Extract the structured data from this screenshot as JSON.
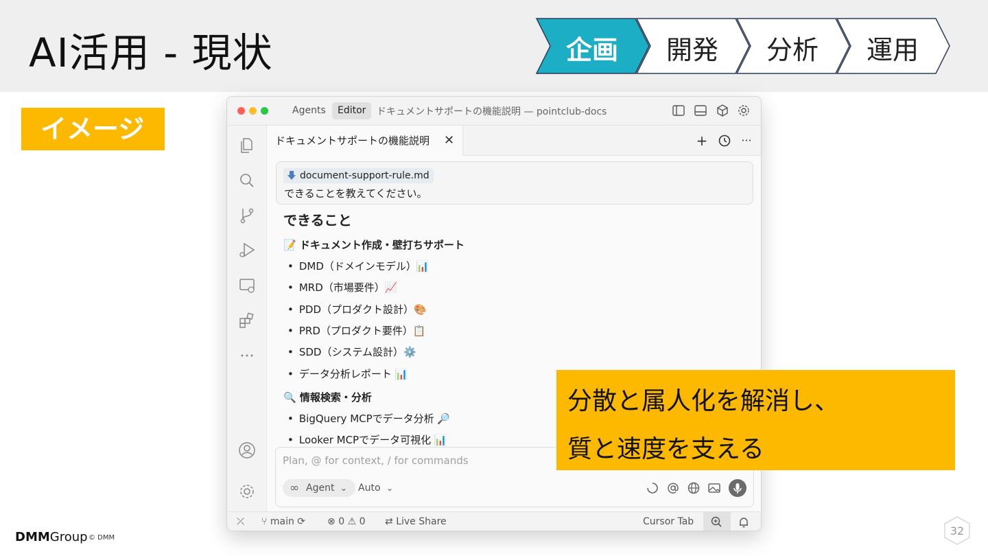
{
  "slide": {
    "title": "AI活用 - 現状",
    "steps": [
      "企画",
      "開発",
      "分析",
      "運用"
    ],
    "active_step_color": "#1baec5",
    "image_tag": "イメージ",
    "callout_lines": [
      "分散と属人化を解消し、",
      "質と速度を支える"
    ],
    "callout_color": "#fcb900",
    "footer_logo_dmm": "DMM",
    "footer_logo_group": "Group",
    "footer_copyright": "© DMM",
    "page_number": "32"
  },
  "window": {
    "mode_buttons": [
      "Agents",
      "Editor"
    ],
    "active_mode": "Editor",
    "title": "ドキュメントサポートの機能説明 — pointclub-docs",
    "titlebar_icons": [
      "sidebar-left-icon",
      "panel-bottom-icon",
      "cube-icon",
      "gear-icon"
    ],
    "sidebar_icons": [
      "files-icon",
      "search-icon",
      "source-control-icon",
      "run-debug-icon",
      "remote-explorer-icon",
      "extensions-icon",
      "more-icon",
      "account-icon",
      "settings-icon"
    ],
    "tab": {
      "label": "ドキュメントサポートの機能説明",
      "close": "✕",
      "tools": [
        "+",
        "history-icon",
        "···"
      ]
    },
    "message": {
      "attachment": "document-support-rule.md",
      "text": "できることを教えてください。"
    },
    "response": {
      "heading": "できること",
      "sections": [
        {
          "title": "📝 ドキュメント作成・壁打ちサポート",
          "items": [
            "DMD（ドメインモデル）📊",
            "MRD（市場要件）📈",
            "PDD（プロダクト設計）🎨",
            "PRD（プロダクト要件）📋",
            "SDD（システム設計）⚙️",
            "データ分析レポート 📊"
          ]
        },
        {
          "title": "🔍 情報検索・分析",
          "items": [
            "BigQuery MCPでデータ分析 🔎",
            "Looker MCPでデータ可視化 📊"
          ]
        }
      ]
    },
    "composer": {
      "placeholder": "Plan, @ for context, / for commands",
      "agent_label": "Agent",
      "agent_chevron": "⌄",
      "model_label": "Auto",
      "model_chevron": "⌄",
      "icons": [
        "loading-icon",
        "at-icon",
        "globe-icon",
        "image-icon",
        "mic-icon"
      ]
    },
    "statusbar": {
      "branch": "main",
      "errors": "0",
      "warnings": "0",
      "live_share": "Live Share",
      "cursor_tab": "Cursor Tab"
    }
  }
}
